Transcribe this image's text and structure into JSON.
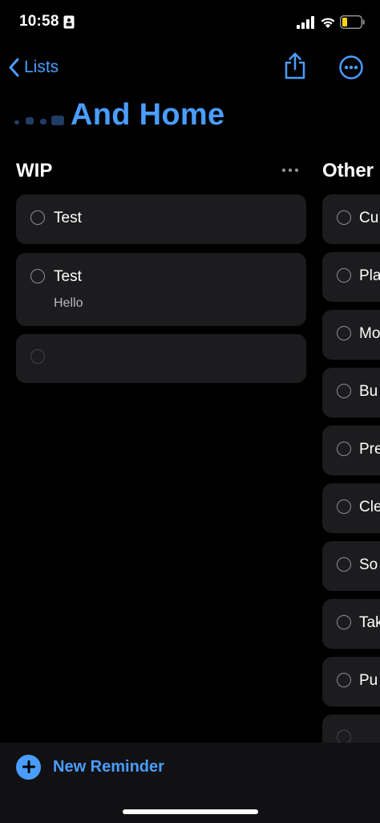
{
  "status": {
    "time": "10:58"
  },
  "nav": {
    "back_label": "Lists"
  },
  "title": "And Home",
  "columns": [
    {
      "title": "WIP",
      "items": [
        {
          "text": "Test",
          "note": ""
        },
        {
          "text": "Test",
          "note": "Hello"
        }
      ]
    },
    {
      "title": "Other",
      "items": [
        {
          "text": "Cu"
        },
        {
          "text": "Pla"
        },
        {
          "text": "Mo"
        },
        {
          "text": "Bu"
        },
        {
          "text": "Pre"
        },
        {
          "text": "Cle"
        },
        {
          "text": "So"
        },
        {
          "text": "Tak"
        },
        {
          "text": "Pu"
        }
      ]
    }
  ],
  "toolbar": {
    "new_reminder_label": "New Reminder"
  },
  "colors": {
    "accent": "#4a9dff",
    "card": "#1c1c1e",
    "background": "#000000"
  }
}
